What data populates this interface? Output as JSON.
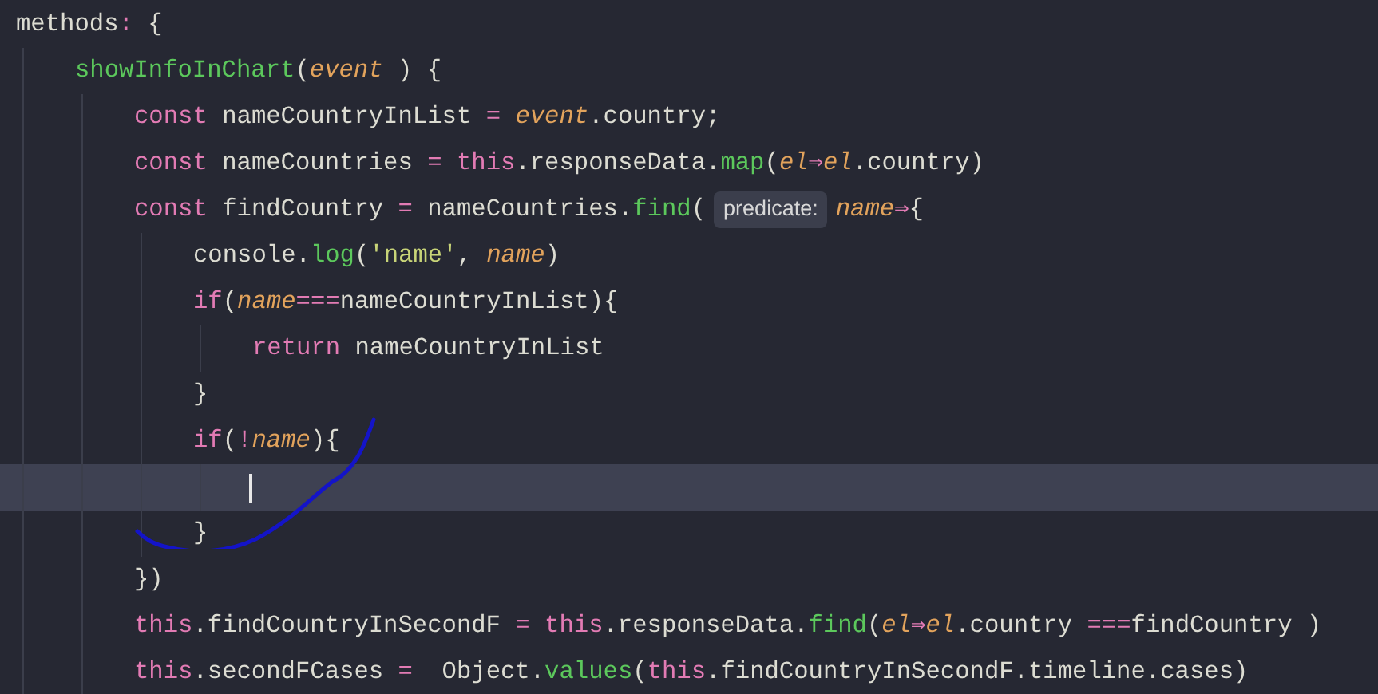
{
  "lines": [
    {
      "current": false,
      "tokens": [
        {
          "kind": "plain",
          "t": "methods"
        },
        {
          "kind": "op",
          "t": ":"
        },
        {
          "kind": "plain",
          "t": " {"
        }
      ],
      "children": [
        {
          "current": false,
          "tokens": [
            {
              "kind": "fn",
              "t": "showInfoInChart"
            },
            {
              "kind": "plain",
              "t": "("
            },
            {
              "kind": "param",
              "t": "event"
            },
            {
              "kind": "plain",
              "t": " ) {"
            }
          ],
          "children": [
            {
              "current": false,
              "tokens": [
                {
                  "kind": "kw",
                  "t": "const"
                },
                {
                  "kind": "plain",
                  "t": " nameCountryInList "
                },
                {
                  "kind": "op",
                  "t": "= "
                },
                {
                  "kind": "param",
                  "t": "event"
                },
                {
                  "kind": "plain",
                  "t": ".country;"
                }
              ]
            },
            {
              "current": false,
              "tokens": [
                {
                  "kind": "kw",
                  "t": "const"
                },
                {
                  "kind": "plain",
                  "t": " nameCountries "
                },
                {
                  "kind": "op",
                  "t": "= "
                },
                {
                  "kind": "kw",
                  "t": "this"
                },
                {
                  "kind": "plain",
                  "t": ".responseData."
                },
                {
                  "kind": "fn",
                  "t": "map"
                },
                {
                  "kind": "plain",
                  "t": "("
                },
                {
                  "kind": "param",
                  "t": "el"
                },
                {
                  "kind": "op",
                  "t": "⇒"
                },
                {
                  "kind": "param",
                  "t": "el"
                },
                {
                  "kind": "plain",
                  "t": ".country)"
                }
              ]
            },
            {
              "current": false,
              "tokens": [
                {
                  "kind": "kw",
                  "t": "const"
                },
                {
                  "kind": "plain",
                  "t": " findCountry "
                },
                {
                  "kind": "op",
                  "t": "="
                },
                {
                  "kind": "plain",
                  "t": " nameCountries."
                },
                {
                  "kind": "fn",
                  "t": "find"
                },
                {
                  "kind": "plain",
                  "t": "("
                },
                {
                  "kind": "hint",
                  "t": "predicate:"
                },
                {
                  "kind": "param",
                  "t": "name"
                },
                {
                  "kind": "op",
                  "t": "⇒"
                },
                {
                  "kind": "plain",
                  "t": "{"
                }
              ],
              "children": [
                {
                  "current": false,
                  "tokens": [
                    {
                      "kind": "plain",
                      "t": "console."
                    },
                    {
                      "kind": "fn",
                      "t": "log"
                    },
                    {
                      "kind": "plain",
                      "t": "("
                    },
                    {
                      "kind": "str",
                      "t": "'name'"
                    },
                    {
                      "kind": "plain",
                      "t": ", "
                    },
                    {
                      "kind": "param",
                      "t": "name"
                    },
                    {
                      "kind": "plain",
                      "t": ")"
                    }
                  ]
                },
                {
                  "current": false,
                  "tokens": [
                    {
                      "kind": "kw",
                      "t": "if"
                    },
                    {
                      "kind": "plain",
                      "t": "("
                    },
                    {
                      "kind": "param",
                      "t": "name"
                    },
                    {
                      "kind": "op",
                      "t": "==="
                    },
                    {
                      "kind": "plain",
                      "t": "nameCountryInList){"
                    }
                  ],
                  "children": [
                    {
                      "current": false,
                      "tokens": [
                        {
                          "kind": "kw",
                          "t": "return"
                        },
                        {
                          "kind": "plain",
                          "t": " nameCountryInList"
                        }
                      ]
                    }
                  ]
                },
                {
                  "current": false,
                  "tokens": [
                    {
                      "kind": "plain",
                      "t": "}"
                    }
                  ]
                },
                {
                  "current": false,
                  "tokens": [
                    {
                      "kind": "kw",
                      "t": "if"
                    },
                    {
                      "kind": "plain",
                      "t": "("
                    },
                    {
                      "kind": "op",
                      "t": "!"
                    },
                    {
                      "kind": "param",
                      "t": "name"
                    },
                    {
                      "kind": "plain",
                      "t": "){"
                    }
                  ],
                  "children": [
                    {
                      "current": true
                    }
                  ]
                },
                {
                  "current": false,
                  "tokens": [
                    {
                      "kind": "plain",
                      "t": "}"
                    }
                  ]
                }
              ]
            },
            {
              "current": false,
              "tokens": [
                {
                  "kind": "plain",
                  "t": "})"
                }
              ]
            },
            {
              "current": false,
              "tokens": [
                {
                  "kind": "kw",
                  "t": "this"
                },
                {
                  "kind": "plain",
                  "t": ".findCountryInSecondF "
                },
                {
                  "kind": "op",
                  "t": "= "
                },
                {
                  "kind": "kw",
                  "t": "this"
                },
                {
                  "kind": "plain",
                  "t": ".responseData."
                },
                {
                  "kind": "fn",
                  "t": "find"
                },
                {
                  "kind": "plain",
                  "t": "("
                },
                {
                  "kind": "param",
                  "t": "el"
                },
                {
                  "kind": "op",
                  "t": "⇒"
                },
                {
                  "kind": "param",
                  "t": "el"
                },
                {
                  "kind": "plain",
                  "t": ".country "
                },
                {
                  "kind": "op",
                  "t": "==="
                },
                {
                  "kind": "plain",
                  "t": "findCountry )"
                }
              ]
            },
            {
              "current": false,
              "tokens": [
                {
                  "kind": "kw",
                  "t": "this"
                },
                {
                  "kind": "plain",
                  "t": ".secondFCases "
                },
                {
                  "kind": "op",
                  "t": "="
                },
                {
                  "kind": "plain",
                  "t": "  Object."
                },
                {
                  "kind": "fn",
                  "t": "values"
                },
                {
                  "kind": "plain",
                  "t": "("
                },
                {
                  "kind": "kw",
                  "t": "this"
                },
                {
                  "kind": "plain",
                  "t": ".findCountryInSecondF.timeline.cases)"
                }
              ]
            }
          ]
        }
      ]
    }
  ]
}
